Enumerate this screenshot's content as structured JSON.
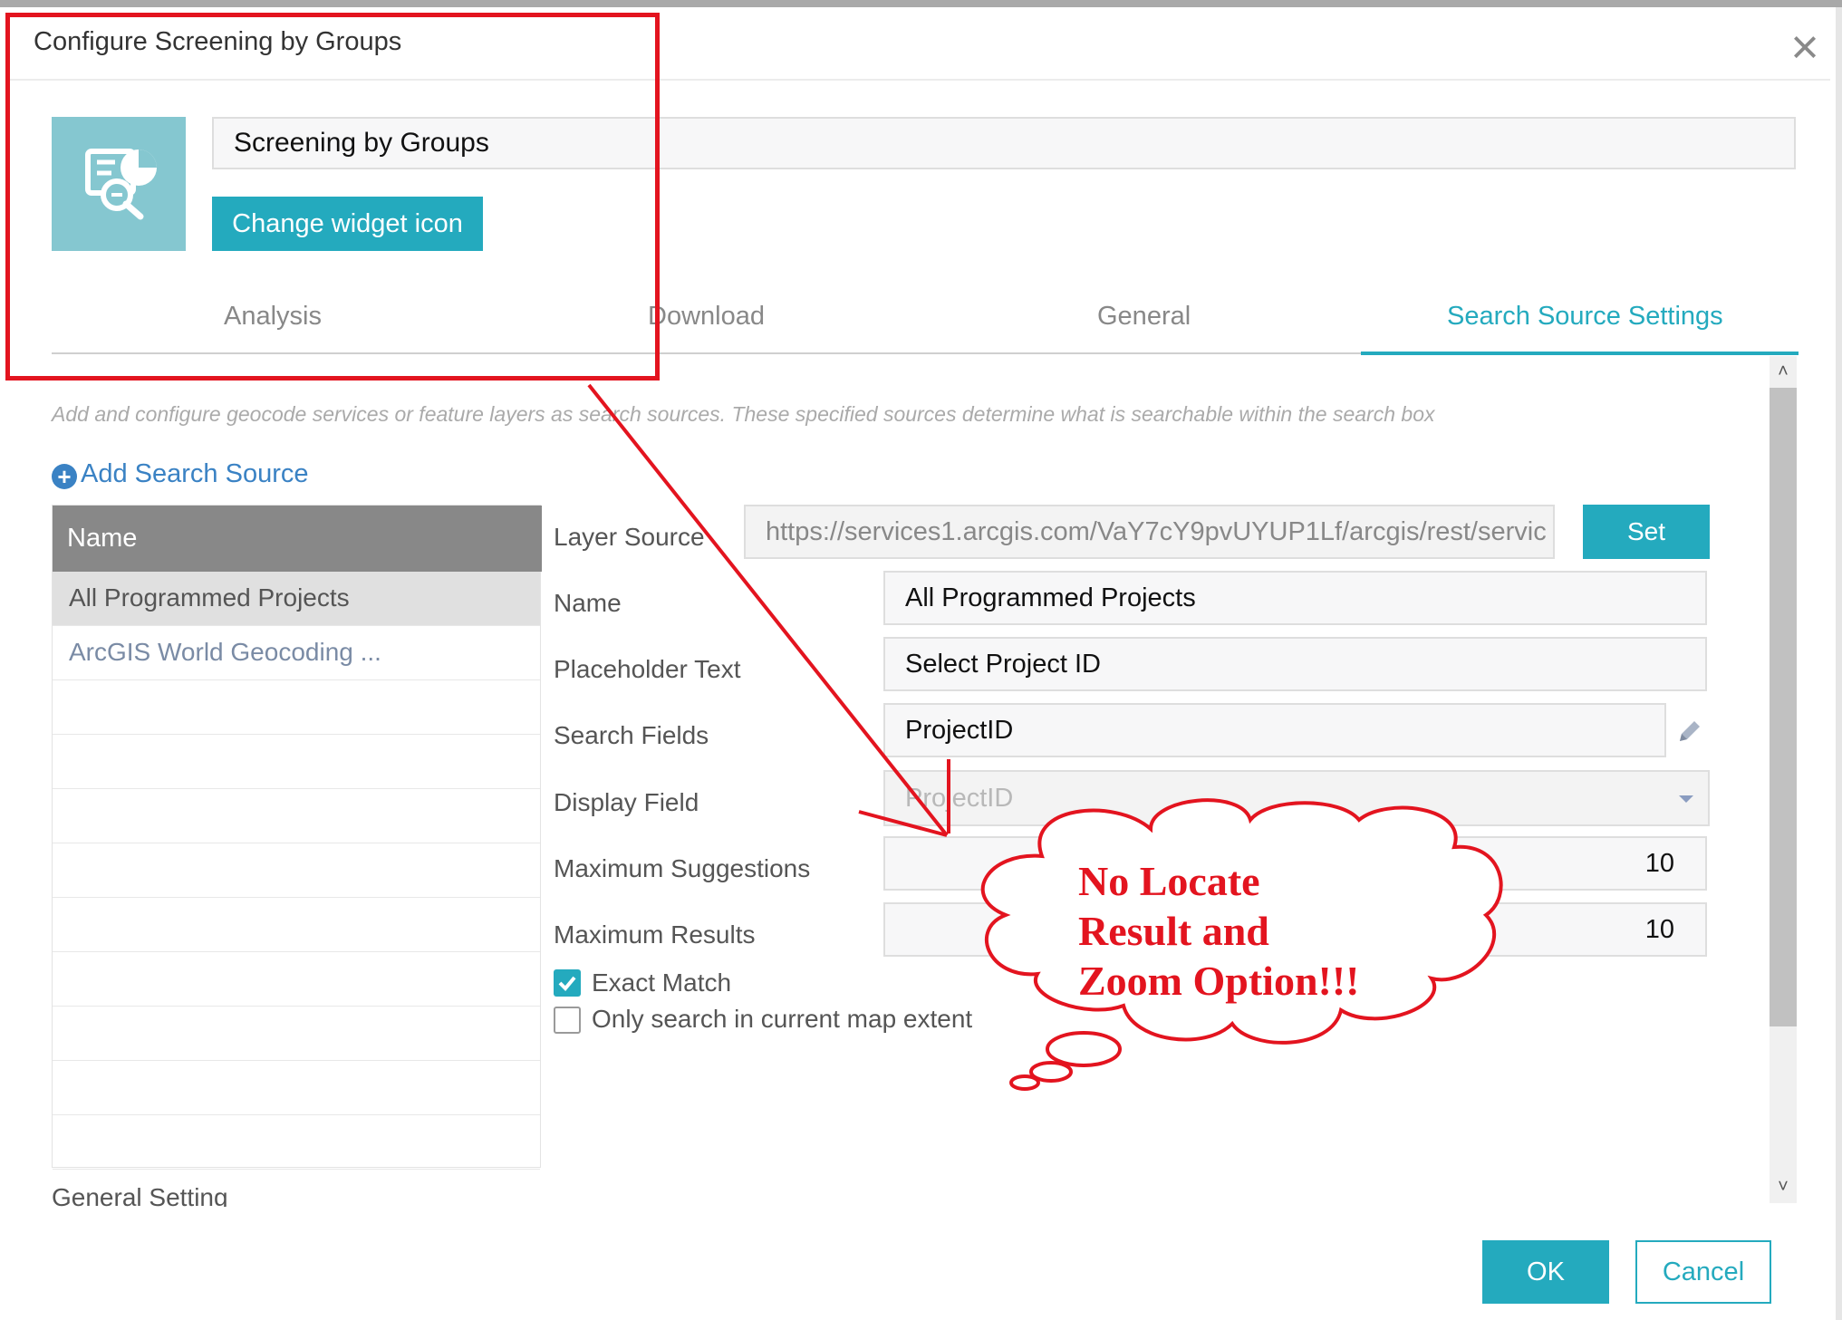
{
  "dialog": {
    "title": "Configure Screening by Groups",
    "close_icon": "close-icon"
  },
  "widget": {
    "name_value": "Screening by Groups",
    "change_icon_label": "Change widget icon",
    "icon": "screening-widget-icon"
  },
  "tabs": [
    {
      "label": "Analysis",
      "active": false
    },
    {
      "label": "Download",
      "active": false
    },
    {
      "label": "General",
      "active": false
    },
    {
      "label": "Search Source Settings",
      "active": true
    }
  ],
  "description": "Add and configure geocode services or feature layers as search sources. These specified sources determine what is searchable within the search box",
  "add_search_source_label": "Add Search Source",
  "sources_list": {
    "header": "Name",
    "items": [
      "All Programmed Projects",
      "ArcGIS World Geocoding ..."
    ]
  },
  "form": {
    "layer_source_label": "Layer Source",
    "layer_source_value": "https://services1.arcgis.com/VaY7cY9pvUYUP1Lf/arcgis/rest/servic",
    "set_label": "Set",
    "name_label": "Name",
    "name_value": "All Programmed Projects",
    "placeholder_label": "Placeholder Text",
    "placeholder_value": "Select Project ID",
    "search_fields_label": "Search Fields",
    "search_fields_value": "ProjectID",
    "display_field_label": "Display Field",
    "display_field_value": "ProjectID",
    "max_suggestions_label": "Maximum Suggestions",
    "max_suggestions_value": "10",
    "max_results_label": "Maximum Results",
    "max_results_value": "10",
    "exact_match_label": "Exact Match",
    "exact_match_checked": true,
    "extent_label": "Only search in current map extent",
    "extent_checked": false
  },
  "general_setting_label": "General Setting",
  "footer": {
    "ok_label": "OK",
    "cancel_label": "Cancel"
  },
  "annotation": {
    "lines": [
      "No Locate",
      "Result and",
      "Zoom Option!!!"
    ],
    "color": "#e3141f"
  },
  "colors": {
    "accent": "#24aabe",
    "icon_bg": "#85c7d0",
    "list_header": "#888888",
    "link": "#3a82c4"
  }
}
